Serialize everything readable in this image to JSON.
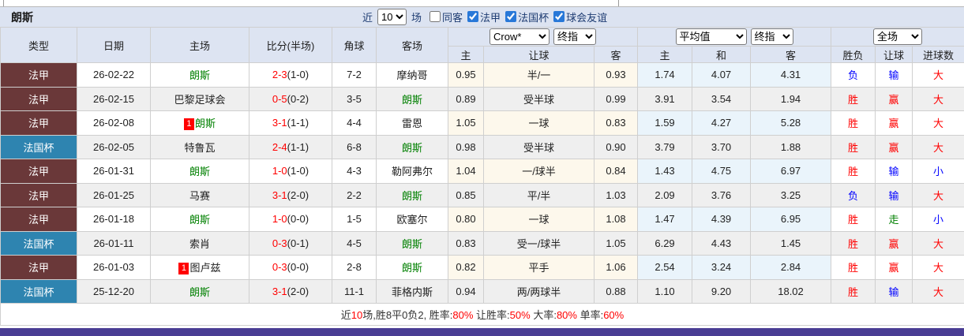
{
  "title": {
    "team": "朗斯"
  },
  "filter": {
    "near_label": "近",
    "count_value": "10",
    "unit_label": "场",
    "checkboxes": [
      {
        "label": "同客",
        "checked": false
      },
      {
        "label": "法甲",
        "checked": true
      },
      {
        "label": "法国杯",
        "checked": true
      },
      {
        "label": "球会友谊",
        "checked": true
      }
    ]
  },
  "table": {
    "main_headers": [
      "类型",
      "日期",
      "主场",
      "比分(半场)",
      "角球",
      "客场"
    ],
    "group_selects": {
      "odds_company": "Crow*",
      "odds_final": "终指",
      "avg": "平均值",
      "avg_final": "终指",
      "scope": "全场"
    },
    "sub_headers": [
      "主",
      "让球",
      "客",
      "主",
      "和",
      "客",
      "胜负",
      "让球",
      "进球数"
    ],
    "league_colors": {
      "法甲": "#6a3839",
      "法国杯": "#2e84b0"
    },
    "verdict_colors": {
      "胜": "#ff0000",
      "负": "#0000ff",
      "赢": "#ff0000",
      "输": "#0000ff",
      "走": "#008000",
      "大": "#ff0000",
      "小": "#0000ff"
    },
    "team_highlight_color": "#008000",
    "rows": [
      {
        "league": "法甲",
        "date": "26-02-22",
        "badge": "",
        "home": "朗斯",
        "home_team": true,
        "score": "2-3",
        "half": "(1-0)",
        "corner": "7-2",
        "away": "摩纳哥",
        "away_team": false,
        "odds_home": "0.95",
        "handicap": "半/一",
        "odds_away": "0.93",
        "avg_home": "1.74",
        "avg_draw": "4.07",
        "avg_away": "4.31",
        "result": "负",
        "hcp_result": "输",
        "goal_result": "大"
      },
      {
        "league": "法甲",
        "date": "26-02-15",
        "badge": "",
        "home": "巴黎足球会",
        "home_team": false,
        "score": "0-5",
        "half": "(0-2)",
        "corner": "3-5",
        "away": "朗斯",
        "away_team": true,
        "odds_home": "0.89",
        "handicap": "受半球",
        "odds_away": "0.99",
        "avg_home": "3.91",
        "avg_draw": "3.54",
        "avg_away": "1.94",
        "result": "胜",
        "hcp_result": "赢",
        "goal_result": "大"
      },
      {
        "league": "法甲",
        "date": "26-02-08",
        "badge": "1",
        "home": "朗斯",
        "home_team": true,
        "score": "3-1",
        "half": "(1-1)",
        "corner": "4-4",
        "away": "雷恩",
        "away_team": false,
        "odds_home": "1.05",
        "handicap": "一球",
        "odds_away": "0.83",
        "avg_home": "1.59",
        "avg_draw": "4.27",
        "avg_away": "5.28",
        "result": "胜",
        "hcp_result": "赢",
        "goal_result": "大"
      },
      {
        "league": "法国杯",
        "date": "26-02-05",
        "badge": "",
        "home": "特鲁瓦",
        "home_team": false,
        "score": "2-4",
        "half": "(1-1)",
        "corner": "6-8",
        "away": "朗斯",
        "away_team": true,
        "odds_home": "0.98",
        "handicap": "受半球",
        "odds_away": "0.90",
        "avg_home": "3.79",
        "avg_draw": "3.70",
        "avg_away": "1.88",
        "result": "胜",
        "hcp_result": "赢",
        "goal_result": "大"
      },
      {
        "league": "法甲",
        "date": "26-01-31",
        "badge": "",
        "home": "朗斯",
        "home_team": true,
        "score": "1-0",
        "half": "(1-0)",
        "corner": "4-3",
        "away": "勒阿弗尔",
        "away_team": false,
        "odds_home": "1.04",
        "handicap": "一/球半",
        "odds_away": "0.84",
        "avg_home": "1.43",
        "avg_draw": "4.75",
        "avg_away": "6.97",
        "result": "胜",
        "hcp_result": "输",
        "goal_result": "小"
      },
      {
        "league": "法甲",
        "date": "26-01-25",
        "badge": "",
        "home": "马赛",
        "home_team": false,
        "score": "3-1",
        "half": "(2-0)",
        "corner": "2-2",
        "away": "朗斯",
        "away_team": true,
        "odds_home": "0.85",
        "handicap": "平/半",
        "odds_away": "1.03",
        "avg_home": "2.09",
        "avg_draw": "3.76",
        "avg_away": "3.25",
        "result": "负",
        "hcp_result": "输",
        "goal_result": "大"
      },
      {
        "league": "法甲",
        "date": "26-01-18",
        "badge": "",
        "home": "朗斯",
        "home_team": true,
        "score": "1-0",
        "half": "(0-0)",
        "corner": "1-5",
        "away": "欧塞尔",
        "away_team": false,
        "odds_home": "0.80",
        "handicap": "一球",
        "odds_away": "1.08",
        "avg_home": "1.47",
        "avg_draw": "4.39",
        "avg_away": "6.95",
        "result": "胜",
        "hcp_result": "走",
        "goal_result": "小"
      },
      {
        "league": "法国杯",
        "date": "26-01-11",
        "badge": "",
        "home": "索肖",
        "home_team": false,
        "score": "0-3",
        "half": "(0-1)",
        "corner": "4-5",
        "away": "朗斯",
        "away_team": true,
        "odds_home": "0.83",
        "handicap": "受一/球半",
        "odds_away": "1.05",
        "avg_home": "6.29",
        "avg_draw": "4.43",
        "avg_away": "1.45",
        "result": "胜",
        "hcp_result": "赢",
        "goal_result": "大"
      },
      {
        "league": "法甲",
        "date": "26-01-03",
        "badge": "1",
        "home": "图卢兹",
        "home_team": false,
        "score": "0-3",
        "half": "(0-0)",
        "corner": "2-8",
        "away": "朗斯",
        "away_team": true,
        "odds_home": "0.82",
        "handicap": "平手",
        "odds_away": "1.06",
        "avg_home": "2.54",
        "avg_draw": "3.24",
        "avg_away": "2.84",
        "result": "胜",
        "hcp_result": "赢",
        "goal_result": "大"
      },
      {
        "league": "法国杯",
        "date": "25-12-20",
        "badge": "",
        "home": "朗斯",
        "home_team": true,
        "score": "3-1",
        "half": "(2-0)",
        "corner": "11-1",
        "away": "菲格内斯",
        "away_team": false,
        "odds_home": "0.94",
        "handicap": "两/两球半",
        "odds_away": "0.88",
        "avg_home": "1.10",
        "avg_draw": "9.20",
        "avg_away": "18.02",
        "result": "胜",
        "hcp_result": "输",
        "goal_result": "大"
      }
    ]
  },
  "summary": {
    "segments": [
      {
        "t": "近"
      },
      {
        "t": "10",
        "red": true
      },
      {
        "t": "场,胜8平0负2, 胜率:"
      },
      {
        "t": "80%",
        "red": true
      },
      {
        "t": " 让胜率:"
      },
      {
        "t": "50%",
        "red": true
      },
      {
        "t": " 大率:"
      },
      {
        "t": "80%",
        "red": true
      },
      {
        "t": " 单率:"
      },
      {
        "t": "60%",
        "red": true
      }
    ]
  },
  "colors": {
    "header_bg": "#dde4f2",
    "title_bg": "#dce3f1",
    "league_fa_jia": "#6a3839",
    "league_fa_guo_bei": "#2e84b0",
    "team_highlight": "#008000",
    "win_red": "#ff0000",
    "lose_blue": "#0000ff",
    "push_green": "#008000",
    "odds_cream_bg": "#fdf8ec",
    "avg_blue_bg": "#eaf4fb",
    "alt_row_bg": "#efefef",
    "checkbox_accent": "#2878d8",
    "bottom_bar_purple": "#4a3d94"
  }
}
